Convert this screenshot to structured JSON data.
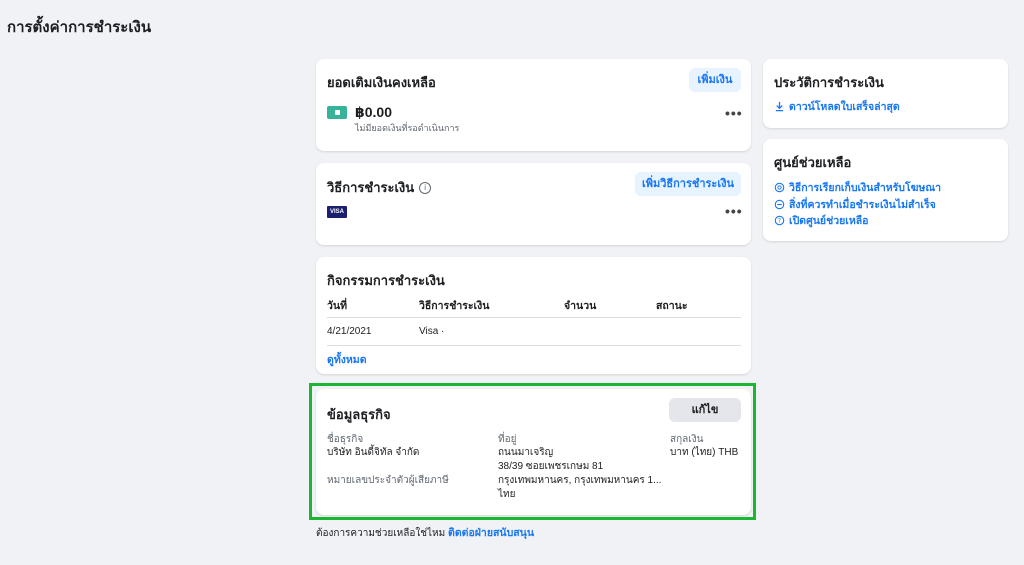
{
  "page_title": "การตั้งค่าการชำระเงิน",
  "balance": {
    "title": "ยอดเติมเงินคงเหลือ",
    "add_label": "เพิ่มเงิน",
    "amount": "฿0.00",
    "note": "ไม่มียอดเงินที่รอดำเนินการ",
    "more": "•••"
  },
  "payment_method": {
    "title": "วิธีการชำระเงิน",
    "add_label": "เพิ่มวิธีการชำระเงิน",
    "card_brand": "VISA",
    "more": "•••"
  },
  "activity": {
    "title": "กิจกรรมการชำระเงิน",
    "columns": [
      "วันที่",
      "วิธีการชำระเงิน",
      "จำนวน",
      "สถานะ"
    ],
    "rows": [
      {
        "date": "4/21/2021",
        "method": "Visa ·",
        "amount": "",
        "status": ""
      }
    ],
    "view_all": "ดูทั้งหมด"
  },
  "business": {
    "title": "ข้อมูลธุรกิจ",
    "edit_label": "แก้ไข",
    "name_label": "ชื่อธุรกิจ",
    "name_value": "บริษัท อินดี้จิทัล จำกัด",
    "tax_label": "หมายเลขประจำตัวผู้เสียภาษี",
    "address_label": "ที่อยู่",
    "address_lines": [
      "ถนนมาเจริญ",
      "38/39 ซอยเพชรเกษม 81",
      "กรุงเทพมหานคร, กรุงเทพมหานคร 1...",
      "ไทย"
    ],
    "currency_label": "สกุลเงิน",
    "currency_value": "บาท (ไทย) THB"
  },
  "footer": {
    "question": "ต้องการความช่วยเหลือใช่ไหม",
    "contact": "ติดต่อฝ่ายสนับสนุน"
  },
  "history": {
    "title": "ประวัติการชำระเงิน",
    "download": "ดาวน์โหลดใบเสร็จล่าสุด"
  },
  "help": {
    "title": "ศูนย์ช่วยเหลือ",
    "links": [
      "วิธีการเรียกเก็บเงินสำหรับโฆษณา",
      "สิ่งที่ควรทำเมื่อชำระเงินไม่สำเร็จ",
      "เปิดศูนย์ช่วยเหลือ"
    ]
  },
  "colors": {
    "accent": "#1877f2",
    "highlight": "#1bb733",
    "wallet": "#36b399",
    "visa": "#1a1f71"
  }
}
